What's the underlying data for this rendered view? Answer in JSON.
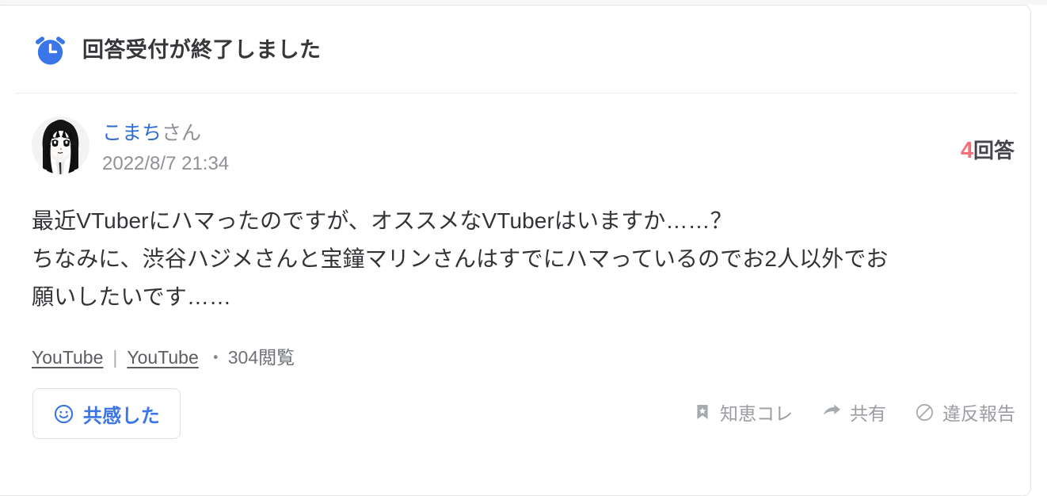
{
  "header": {
    "icon": "alarm-clock-icon",
    "status_text": "回答受付が終了しました",
    "accent_color": "#3b76e8"
  },
  "author": {
    "avatar": "manga-girl-avatar",
    "name": "こまち",
    "name_suffix": "さん",
    "name_color": "#2e6dd0",
    "posted_at": "2022/8/7 21:34"
  },
  "answers": {
    "count": "4",
    "label": "回答",
    "count_color": "#f1707a"
  },
  "question": {
    "lines": [
      "最近VTuberにハマったのですが、オススメなVTuberはいますか……？",
      "ちなみに、渋谷ハジメさんと宝鐘マリンさんはすでにハマっているのでお2人以外でお",
      "願いしたいです……"
    ]
  },
  "meta": {
    "category_primary": "YouTube",
    "separator": "|",
    "category_secondary": "YouTube",
    "dot": "・",
    "views": "304閲覧"
  },
  "footer": {
    "empathy": {
      "icon": "smiley-face-icon",
      "label": "共感した"
    },
    "actions": [
      {
        "icon": "bookmark-star-icon",
        "label": "知恵コレ"
      },
      {
        "icon": "share-arrow-icon",
        "label": "共有"
      },
      {
        "icon": "prohibited-icon",
        "label": "違反報告"
      }
    ]
  }
}
